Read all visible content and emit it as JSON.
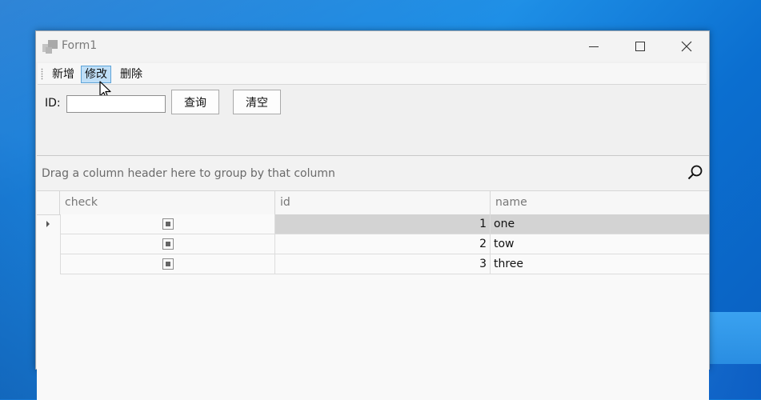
{
  "window": {
    "title": "Form1"
  },
  "toolbar": {
    "add_label": "新增",
    "edit_label": "修改",
    "delete_label": "删除"
  },
  "search": {
    "id_label": "ID:",
    "id_value": "",
    "query_label": "查询",
    "clear_label": "清空"
  },
  "grid": {
    "group_panel_text": "Drag a column header here to group by that column",
    "columns": [
      "check",
      "id",
      "name"
    ],
    "rows": [
      {
        "check": "indeterminate",
        "id": "1",
        "name": "one",
        "focused": true
      },
      {
        "check": "indeterminate",
        "id": "2",
        "name": "tow",
        "focused": false
      },
      {
        "check": "indeterminate",
        "id": "3",
        "name": "three",
        "focused": false
      }
    ]
  },
  "colors": {
    "desktop": "#1a7fd8",
    "selected_tool": "#bfdff7",
    "focused_row": "#d3d3d3"
  }
}
